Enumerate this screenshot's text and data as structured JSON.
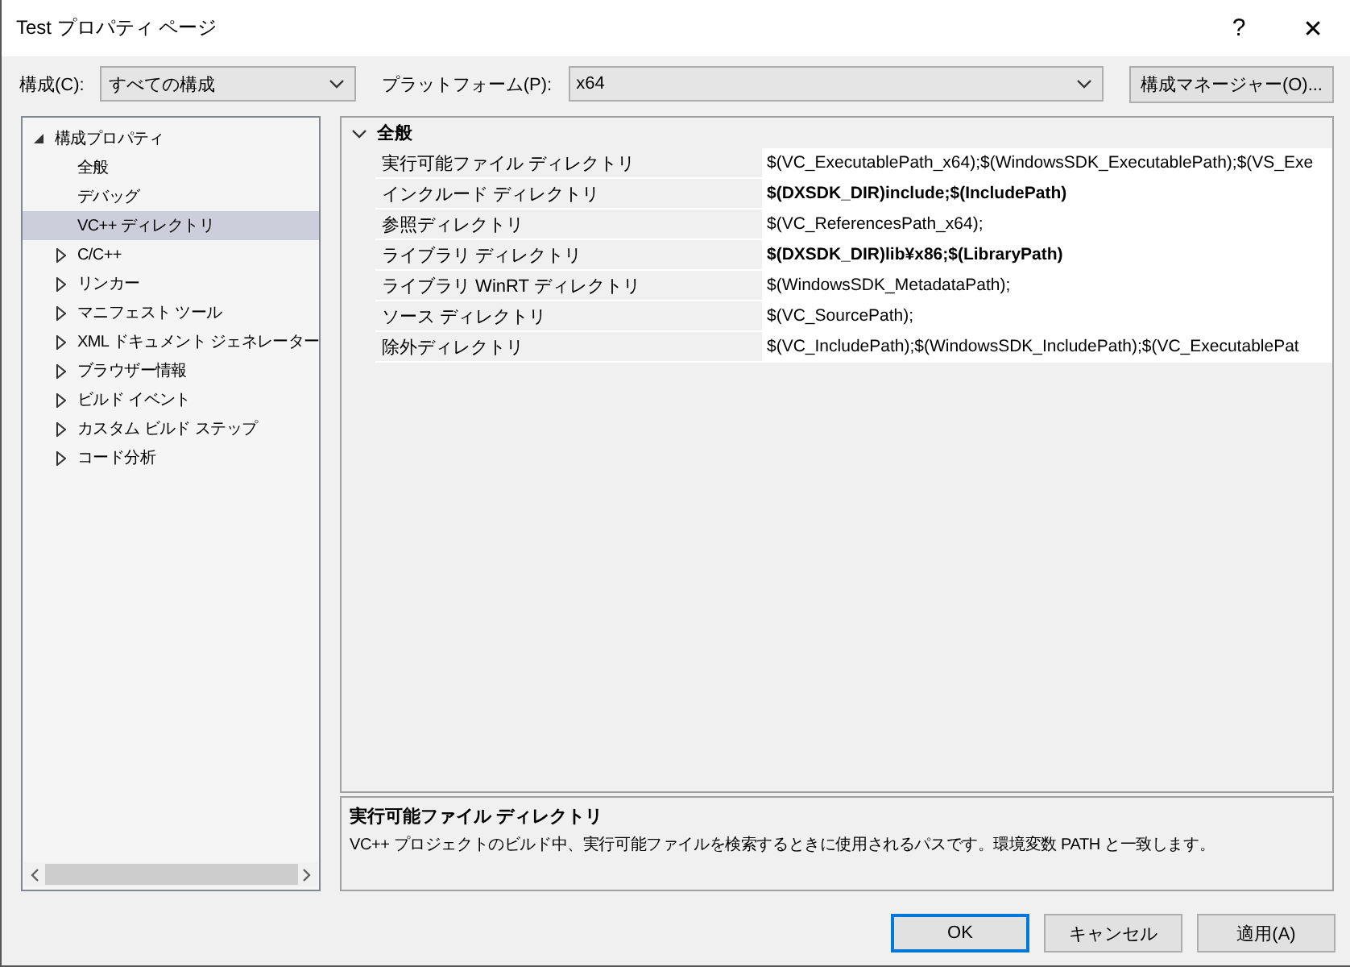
{
  "window": {
    "title": "Test プロパティ ページ",
    "help": "?",
    "close": "✕"
  },
  "toolbar": {
    "configuration": {
      "label": "構成(C):",
      "value": "すべての構成"
    },
    "platform": {
      "label": "プラットフォーム(P):",
      "value": "x64"
    },
    "manager_button": "構成マネージャー(O)..."
  },
  "tree": [
    {
      "label": "構成プロパティ",
      "kind": "group",
      "expanded": true,
      "selected": false,
      "children": [
        {
          "label": "全般",
          "kind": "leaf",
          "selected": false
        },
        {
          "label": "デバッグ",
          "kind": "leaf",
          "selected": false
        },
        {
          "label": "VC++ ディレクトリ",
          "kind": "leaf",
          "selected": true
        },
        {
          "label": "C/C++",
          "kind": "group",
          "expanded": false,
          "selected": false
        },
        {
          "label": "リンカー",
          "kind": "group",
          "expanded": false,
          "selected": false
        },
        {
          "label": "マニフェスト ツール",
          "kind": "group",
          "expanded": false,
          "selected": false
        },
        {
          "label": "XML ドキュメント ジェネレーター",
          "kind": "group",
          "expanded": false,
          "selected": false
        },
        {
          "label": "ブラウザー情報",
          "kind": "group",
          "expanded": false,
          "selected": false
        },
        {
          "label": "ビルド イベント",
          "kind": "group",
          "expanded": false,
          "selected": false
        },
        {
          "label": "カスタム ビルド ステップ",
          "kind": "group",
          "expanded": false,
          "selected": false
        },
        {
          "label": "コード分析",
          "kind": "group",
          "expanded": false,
          "selected": false
        }
      ]
    }
  ],
  "grid": {
    "category": {
      "label": "全般",
      "expanded": true
    },
    "rows": [
      {
        "name": "実行可能ファイル ディレクトリ",
        "value": "$(VC_ExecutablePath_x64);$(WindowsSDK_ExecutablePath);$(VS_Exe",
        "modified": false
      },
      {
        "name": "インクルード ディレクトリ",
        "value": "$(DXSDK_DIR)include;$(IncludePath)",
        "modified": true
      },
      {
        "name": "参照ディレクトリ",
        "value": "$(VC_ReferencesPath_x64);",
        "modified": false
      },
      {
        "name": "ライブラリ ディレクトリ",
        "value": "$(DXSDK_DIR)lib¥x86;$(LibraryPath)",
        "modified": true
      },
      {
        "name": "ライブラリ WinRT ディレクトリ",
        "value": "$(WindowsSDK_MetadataPath);",
        "modified": false
      },
      {
        "name": "ソース ディレクトリ",
        "value": "$(VC_SourcePath);",
        "modified": false
      },
      {
        "name": "除外ディレクトリ",
        "value": "$(VC_IncludePath);$(WindowsSDK_IncludePath);$(VC_ExecutablePat",
        "modified": false
      }
    ]
  },
  "description": {
    "title": "実行可能ファイル ディレクトリ",
    "text": "VC++ プロジェクトのビルド中、実行可能ファイルを検索するときに使用されるパスです。環境変数 PATH と一致します。"
  },
  "buttons": [
    {
      "label": "OK",
      "default": true
    },
    {
      "label": "キャンセル",
      "default": false
    },
    {
      "label": "適用(A)",
      "default": false
    }
  ]
}
